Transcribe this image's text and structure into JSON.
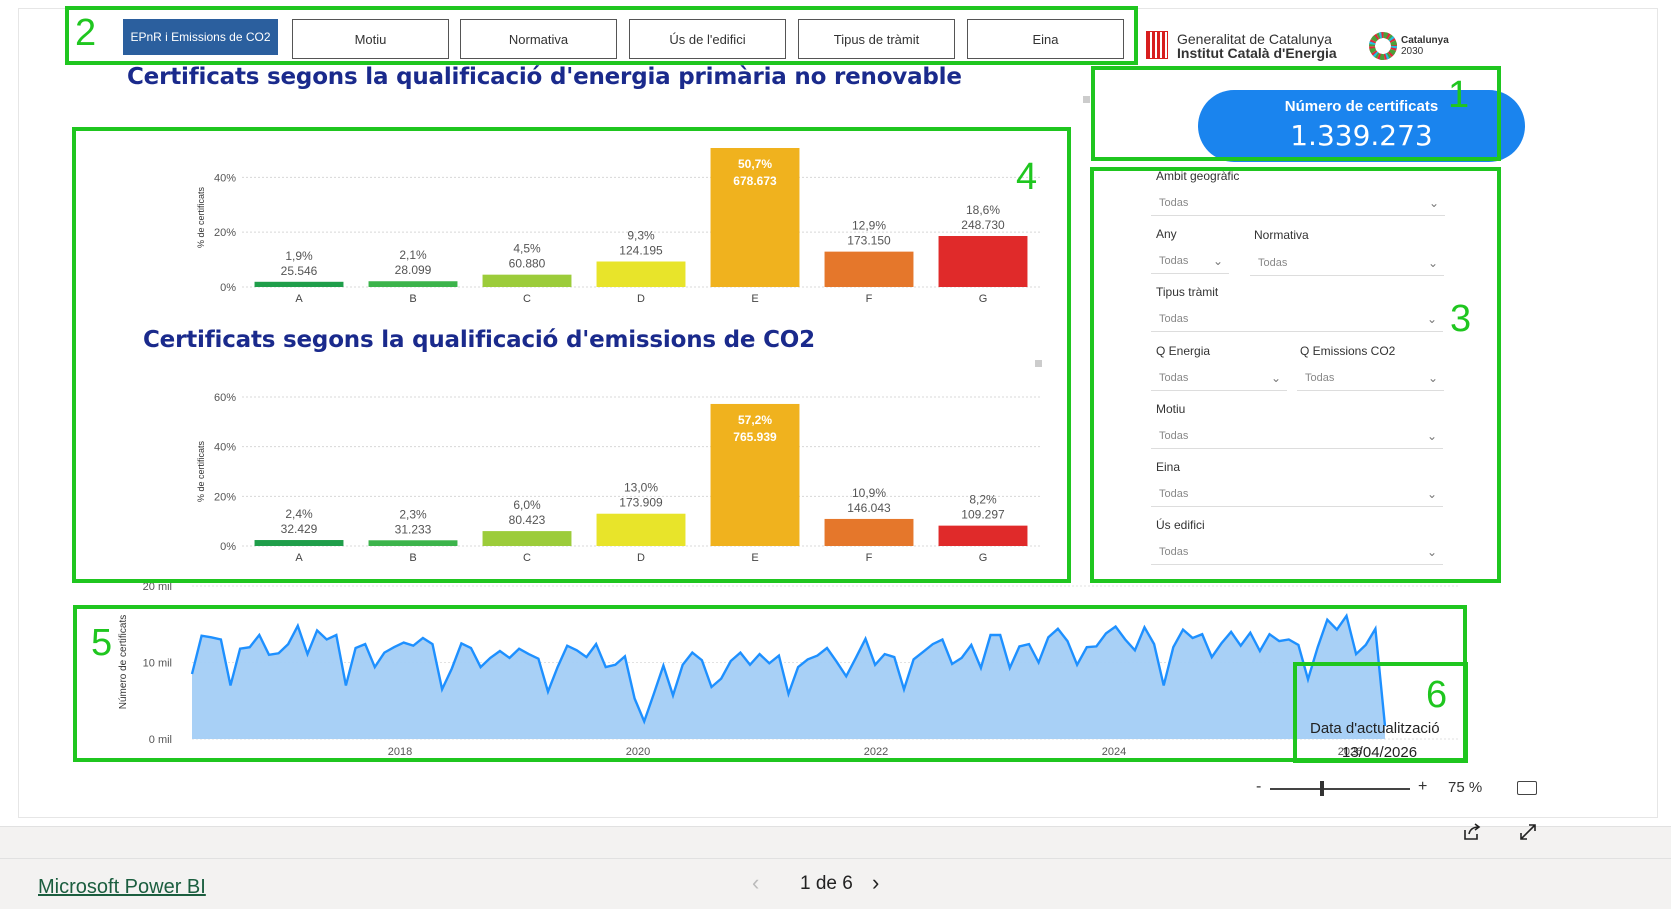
{
  "tabs": [
    {
      "label": "EPnR i Emissions de CO2",
      "active": true
    },
    {
      "label": "Motiu",
      "active": false
    },
    {
      "label": "Normativa",
      "active": false
    },
    {
      "label": "Ús de l'edifici",
      "active": false
    },
    {
      "label": "Tipus de tràmit",
      "active": false
    },
    {
      "label": "Eina",
      "active": false
    }
  ],
  "logos": {
    "gencat_line1": "Generalitat de Catalunya",
    "gencat_line2": "Institut Català d'Energia",
    "cat2030_line1": "Catalunya",
    "cat2030_line2": "2030"
  },
  "kpi": {
    "label": "Número de certificats",
    "value": "1.339.273"
  },
  "callouts": [
    "1",
    "2",
    "3",
    "4",
    "5",
    "6"
  ],
  "slicers": {
    "ambit": {
      "label": "Àmbit geogràfic",
      "value": "Todas"
    },
    "any": {
      "label": "Any",
      "value": "Todas"
    },
    "normativa": {
      "label": "Normativa",
      "value": "Todas"
    },
    "tramit": {
      "label": "Tipus tràmit",
      "value": "Todas"
    },
    "qenergia": {
      "label": "Q Energia",
      "value": "Todas"
    },
    "qemissions": {
      "label": "Q Emissions CO2",
      "value": "Todas"
    },
    "motiu": {
      "label": "Motiu",
      "value": "Todas"
    },
    "eina": {
      "label": "Eina",
      "value": "Todas"
    },
    "us": {
      "label": "Ús edifici",
      "value": "Todas"
    }
  },
  "update": {
    "label": "Data d'actualització",
    "value": "13/04/2026"
  },
  "zoom": {
    "minus": "-",
    "plus": "+",
    "value": "75 %"
  },
  "footer": {
    "brand": "Microsoft Power BI",
    "page": "1 de 6"
  },
  "chart_data": [
    {
      "type": "bar",
      "title": "Certificats segons la qualificació d'energia primària no renovable",
      "ylabel": "% de certificats",
      "categories": [
        "A",
        "B",
        "C",
        "D",
        "E",
        "F",
        "G"
      ],
      "values": [
        1.9,
        2.1,
        4.5,
        9.3,
        50.7,
        12.9,
        18.6
      ],
      "pct_labels": [
        "1,9%",
        "2,1%",
        "4,5%",
        "9,3%",
        "50,7%",
        "12,9%",
        "18,6%"
      ],
      "count_labels": [
        "25.546",
        "28.099",
        "60.880",
        "124.195",
        "678.673",
        "173.150",
        "248.730"
      ],
      "yticks": [
        "0%",
        "20%",
        "40%"
      ],
      "ylim": [
        0,
        50.7
      ],
      "colors": [
        "#1f9e4a",
        "#3cb44b",
        "#9ccc3a",
        "#e8e42a",
        "#f0b21e",
        "#e5772b",
        "#e02a2a"
      ]
    },
    {
      "type": "bar",
      "title": "Certificats segons la qualificació d'emissions de CO2",
      "ylabel": "% de certificats",
      "categories": [
        "A",
        "B",
        "C",
        "D",
        "E",
        "F",
        "G"
      ],
      "values": [
        2.4,
        2.3,
        6.0,
        13.0,
        57.2,
        10.9,
        8.2
      ],
      "pct_labels": [
        "2,4%",
        "2,3%",
        "6,0%",
        "13,0%",
        "57,2%",
        "10,9%",
        "8,2%"
      ],
      "count_labels": [
        "32.429",
        "31.233",
        "80.423",
        "173.909",
        "765.939",
        "146.043",
        "109.297"
      ],
      "yticks": [
        "0%",
        "20%",
        "40%",
        "60%"
      ],
      "ylim": [
        0,
        60
      ],
      "colors": [
        "#1f9e4a",
        "#3cb44b",
        "#9ccc3a",
        "#e8e42a",
        "#f0b21e",
        "#e5772b",
        "#e02a2a"
      ]
    },
    {
      "type": "area",
      "ylabel": "Número de certificats",
      "yticks": [
        "0 mil",
        "10 mil",
        "20 mil"
      ],
      "ylim": [
        0,
        20
      ],
      "xticks": [
        "2018",
        "2020",
        "2022",
        "2024",
        "2026"
      ],
      "x_start": "2016-06",
      "values": [
        8.5,
        13.5,
        13.3,
        13,
        7,
        11.8,
        12,
        13.6,
        11,
        11.2,
        12.4,
        14.8,
        11.1,
        14.2,
        13,
        13.6,
        7,
        11.9,
        12.4,
        9.4,
        11.3,
        12,
        12.6,
        12.2,
        13.2,
        12.4,
        6.5,
        9.2,
        12.5,
        11.9,
        9.4,
        10.6,
        11.5,
        10.6,
        11.8,
        11.1,
        10.5,
        6.2,
        9.4,
        12.2,
        11.6,
        10.7,
        12.4,
        9.4,
        9.7,
        10.8,
        5.3,
        2.3,
        5.9,
        9.6,
        5.7,
        9.7,
        11.3,
        10.3,
        6.8,
        7.9,
        10.2,
        11.3,
        9.7,
        11.1,
        9.9,
        10.9,
        5.9,
        9.4,
        10.4,
        10.9,
        11.9,
        10.1,
        8.2,
        10.6,
        13.1,
        9.7,
        11.1,
        10.7,
        6.5,
        10.4,
        11.4,
        12.4,
        13,
        9.8,
        10.6,
        12.3,
        9.3,
        13.6,
        13.6,
        9.3,
        12.1,
        12.4,
        10,
        13.3,
        14.4,
        12.8,
        9.7,
        12,
        12.1,
        13.8,
        14.7,
        13,
        11.6,
        14.6,
        12.4,
        7,
        12,
        14.3,
        13.2,
        13.7,
        10.7,
        12.5,
        14,
        12.2,
        13.9,
        11.5,
        13.7,
        12.8,
        13,
        12.3,
        7.8,
        12,
        15.6,
        14.3,
        16.1,
        11.1,
        12.3,
        14.4,
        1.7
      ],
      "color": "#1e90ff",
      "fill": "#a3cdf5"
    }
  ]
}
